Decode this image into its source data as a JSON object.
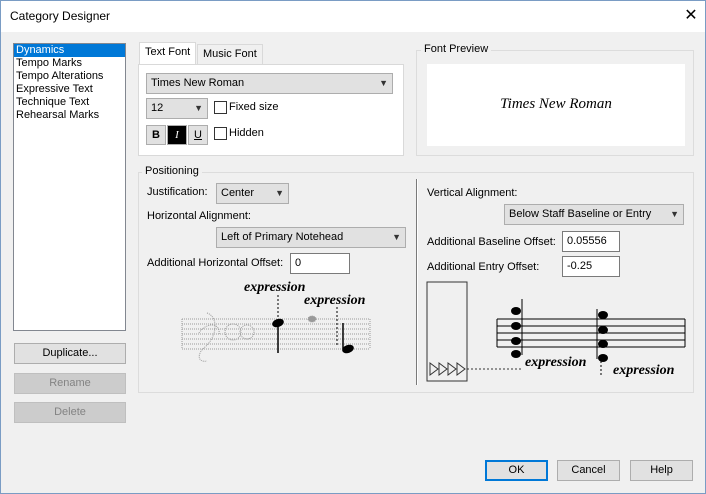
{
  "window": {
    "title": "Category Designer",
    "close_glyph": "✕"
  },
  "categories": {
    "items": [
      "Dynamics",
      "Tempo Marks",
      "Tempo Alterations",
      "Expressive Text",
      "Technique Text",
      "Rehearsal Marks"
    ],
    "selected_index": 0
  },
  "left_buttons": {
    "duplicate": "Duplicate...",
    "rename": "Rename",
    "delete": "Delete"
  },
  "tabs": {
    "text_font": "Text Font",
    "music_font": "Music Font",
    "active": "Text Font"
  },
  "font": {
    "family": "Times New Roman",
    "size": "12",
    "fixed_size_label": "Fixed size",
    "fixed_size_checked": false,
    "hidden_label": "Hidden",
    "hidden_checked": false,
    "bold_label": "B",
    "italic_label": "I",
    "underline_label": "U",
    "italic_on": true
  },
  "font_preview": {
    "label": "Font Preview",
    "sample": "Times New Roman"
  },
  "positioning": {
    "label": "Positioning",
    "justification_label": "Justification:",
    "justification_value": "Center",
    "horizontal_alignment_label": "Horizontal Alignment:",
    "horizontal_alignment_value": "Left of Primary Notehead",
    "additional_horizontal_offset_label": "Additional Horizontal Offset:",
    "additional_horizontal_offset_value": "0",
    "vertical_alignment_label": "Vertical Alignment:",
    "vertical_alignment_value": "Below Staff Baseline or Entry",
    "additional_baseline_offset_label": "Additional Baseline Offset:",
    "additional_baseline_offset_value": "0.05556",
    "additional_entry_offset_label": "Additional Entry Offset:",
    "additional_entry_offset_value": "-0.25",
    "example_text": "expression"
  },
  "footer": {
    "ok": "OK",
    "cancel": "Cancel",
    "help": "Help"
  },
  "colors": {
    "selection": "#0078d7",
    "dialog_bg": "#f0f0f0",
    "default_button_border": "#0078d7"
  },
  "icons": {
    "close": "close-icon",
    "dropdown": "chevron-down-icon"
  }
}
